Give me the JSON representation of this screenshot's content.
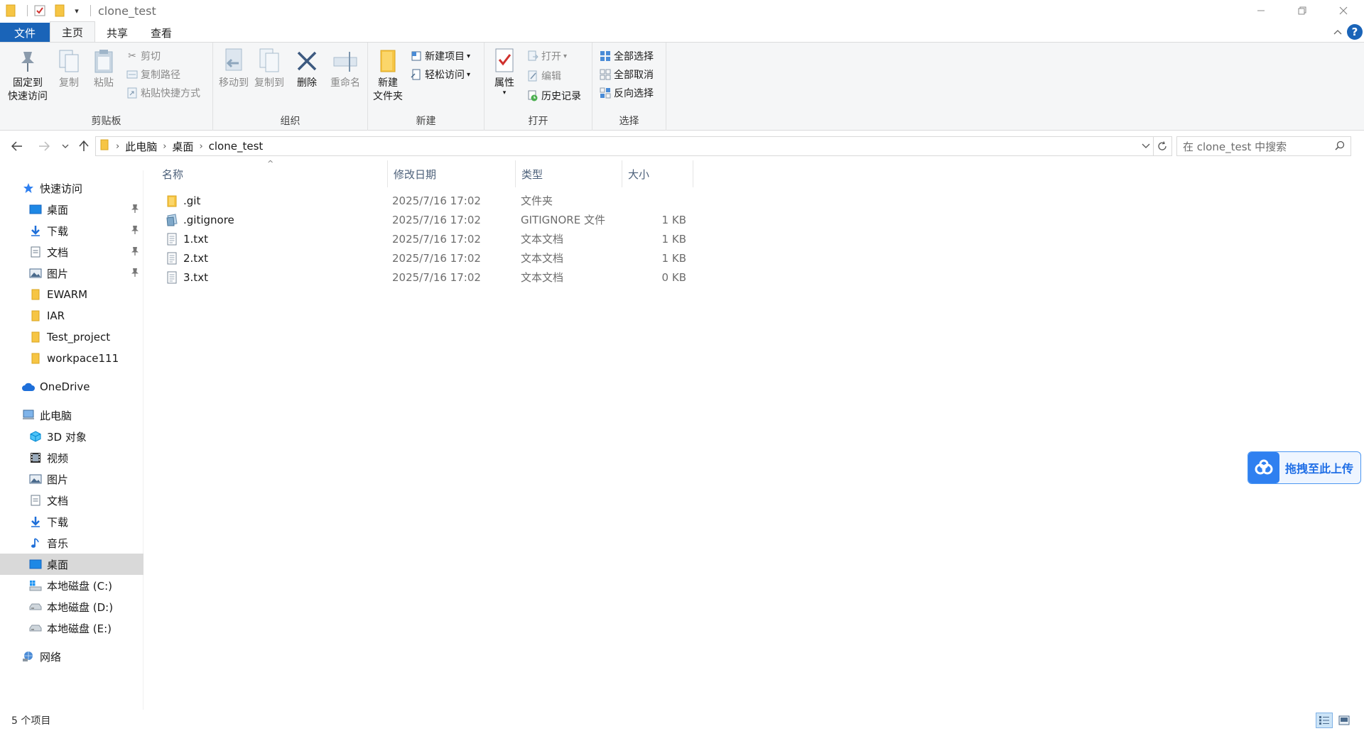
{
  "window": {
    "title": "clone_test"
  },
  "ribbon_tabs": [
    {
      "label": "文件"
    },
    {
      "label": "主页"
    },
    {
      "label": "共享"
    },
    {
      "label": "查看"
    }
  ],
  "ribbon": {
    "clipboard": {
      "label": "剪贴板",
      "pin_label_1": "固定到",
      "pin_label_2": "快速访问",
      "copy": "复制",
      "paste": "粘贴",
      "cut": "剪切",
      "copy_path": "复制路径",
      "paste_shortcut": "粘贴快捷方式"
    },
    "organize": {
      "label": "组织",
      "move_to": "移动到",
      "copy_to": "复制到",
      "delete": "删除",
      "rename": "重命名"
    },
    "new": {
      "label": "新建",
      "new_folder_1": "新建",
      "new_folder_2": "文件夹",
      "new_item": "新建项目",
      "easy_access": "轻松访问"
    },
    "open": {
      "label": "打开",
      "properties": "属性",
      "open": "打开",
      "edit": "编辑",
      "history": "历史记录"
    },
    "select": {
      "label": "选择",
      "select_all": "全部选择",
      "select_none": "全部取消",
      "invert": "反向选择"
    }
  },
  "address": {
    "crumbs": [
      "此电脑",
      "桌面",
      "clone_test"
    ],
    "search_placeholder": "在 clone_test 中搜索"
  },
  "nav": {
    "quick_access": "快速访问",
    "quick_items": [
      {
        "label": "桌面",
        "pinned": true,
        "icon": "desktop-icon"
      },
      {
        "label": "下载",
        "pinned": true,
        "icon": "download-icon"
      },
      {
        "label": "文档",
        "pinned": true,
        "icon": "document-icon"
      },
      {
        "label": "图片",
        "pinned": true,
        "icon": "picture-icon"
      },
      {
        "label": "EWARM",
        "pinned": false,
        "icon": "folder-icon"
      },
      {
        "label": "IAR",
        "pinned": false,
        "icon": "folder-icon"
      },
      {
        "label": "Test_project",
        "pinned": false,
        "icon": "folder-icon"
      },
      {
        "label": "workpace111",
        "pinned": false,
        "icon": "folder-icon"
      }
    ],
    "onedrive": "OneDrive",
    "this_pc": "此电脑",
    "pc_items": [
      {
        "label": "3D 对象",
        "icon": "3d-objects-icon"
      },
      {
        "label": "视频",
        "icon": "video-icon"
      },
      {
        "label": "图片",
        "icon": "picture-icon"
      },
      {
        "label": "文档",
        "icon": "document-icon"
      },
      {
        "label": "下载",
        "icon": "download-icon"
      },
      {
        "label": "音乐",
        "icon": "music-icon"
      },
      {
        "label": "桌面",
        "icon": "desktop-icon",
        "selected": true
      },
      {
        "label": "本地磁盘 (C:)",
        "icon": "system-drive-icon"
      },
      {
        "label": "本地磁盘 (D:)",
        "icon": "drive-icon"
      },
      {
        "label": "本地磁盘 (E:)",
        "icon": "drive-icon"
      }
    ],
    "network": "网络"
  },
  "columns": {
    "name": "名称",
    "date": "修改日期",
    "type": "类型",
    "size": "大小"
  },
  "files": [
    {
      "name": ".git",
      "date": "2025/7/16 17:02",
      "type": "文件夹",
      "size": "",
      "icon": "folder-icon"
    },
    {
      "name": ".gitignore",
      "date": "2025/7/16 17:02",
      "type": "GITIGNORE 文件",
      "size": "1 KB",
      "icon": "gitignore-file-icon"
    },
    {
      "name": "1.txt",
      "date": "2025/7/16 17:02",
      "type": "文本文档",
      "size": "1 KB",
      "icon": "text-file-icon"
    },
    {
      "name": "2.txt",
      "date": "2025/7/16 17:02",
      "type": "文本文档",
      "size": "1 KB",
      "icon": "text-file-icon"
    },
    {
      "name": "3.txt",
      "date": "2025/7/16 17:02",
      "type": "文本文档",
      "size": "0 KB",
      "icon": "text-file-icon"
    }
  ],
  "status": {
    "count": "5 个项目"
  },
  "upload_widget": {
    "label": "拖拽至此上传"
  },
  "colors": {
    "accent": "#1a64b8",
    "folder": "#f6c544",
    "selection": "#d9d9d9"
  }
}
